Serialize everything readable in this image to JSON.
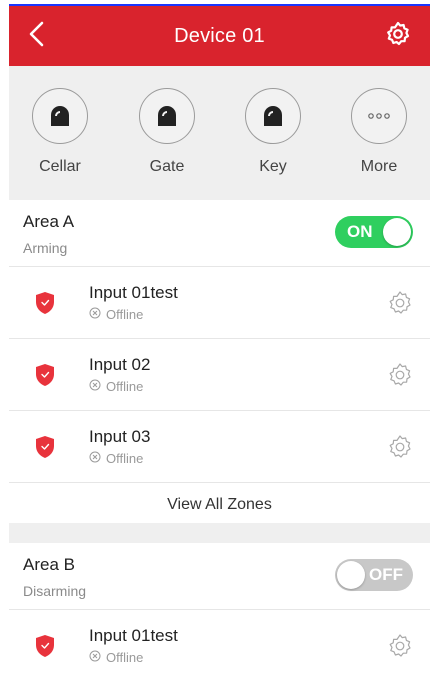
{
  "header": {
    "title": "Device 01",
    "back_icon": "chevron-left-icon",
    "settings_icon": "gear-icon",
    "background": "#d9232d"
  },
  "shortcuts": [
    {
      "label": "Cellar",
      "icon": "siren-icon"
    },
    {
      "label": "Gate",
      "icon": "siren-icon"
    },
    {
      "label": "Key",
      "icon": "siren-icon"
    },
    {
      "label": "More",
      "icon": "more-dots-icon"
    }
  ],
  "areas": [
    {
      "name": "Area A",
      "state": "Arming",
      "toggle": {
        "label": "ON",
        "on": true,
        "color": "#2fcf5f"
      },
      "zones": [
        {
          "name": "Input 01test",
          "status": "Offline"
        },
        {
          "name": "Input 02",
          "status": "Offline"
        },
        {
          "name": "Input 03",
          "status": "Offline"
        }
      ],
      "view_all_label": "View All Zones"
    },
    {
      "name": "Area B",
      "state": "Disarming",
      "toggle": {
        "label": "OFF",
        "on": false,
        "color": "#c8c8c8"
      },
      "zones": [
        {
          "name": "Input 01test",
          "status": "Offline"
        }
      ]
    }
  ],
  "colors": {
    "accent_red": "#d9232d",
    "zone_shield": "#e8333c",
    "toggle_on": "#2fcf5f",
    "toggle_off": "#c8c8c8"
  }
}
